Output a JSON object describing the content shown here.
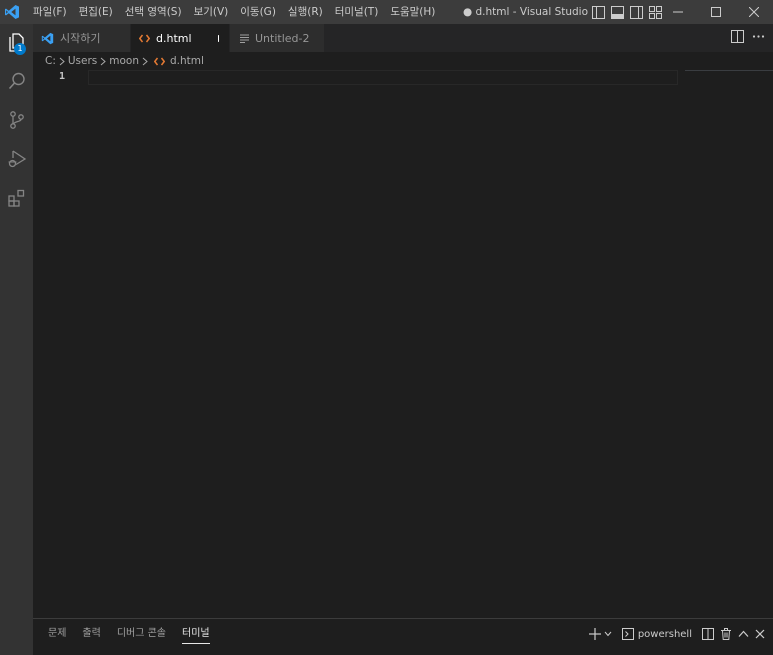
{
  "titlebar": {
    "menu": [
      "파일(F)",
      "편집(E)",
      "선택 영역(S)",
      "보기(V)",
      "이동(G)",
      "실행(R)",
      "터미널(T)",
      "도움말(H)"
    ],
    "title": "● d.html - Visual Studio Co..."
  },
  "activitybar": {
    "items": [
      "explorer-icon",
      "search-icon",
      "source-control-icon",
      "run-debug-icon",
      "extensions-icon"
    ],
    "explorer_badge": "1"
  },
  "tabs": [
    {
      "label": "시작하기",
      "icon": "vscode-logo-icon"
    },
    {
      "label": "d.html",
      "icon": "html-file-icon",
      "modified": true
    },
    {
      "label": "Untitled-2",
      "icon": "text-file-icon"
    }
  ],
  "breadcrumb": {
    "parts": [
      "C:",
      "Users",
      "moon"
    ],
    "file": "d.html"
  },
  "editor": {
    "line_numbers": [
      "1"
    ]
  },
  "panel": {
    "tabs": [
      "문제",
      "출력",
      "디버그 콘솔",
      "터미널"
    ],
    "active_tab": "터미널",
    "terminal_name": "powershell"
  },
  "colors": {
    "accent": "#007acc",
    "titlebar": "#3c3c3c",
    "activitybar": "#333333",
    "editor": "#1e1e1e",
    "html_icon": "#e37933"
  }
}
